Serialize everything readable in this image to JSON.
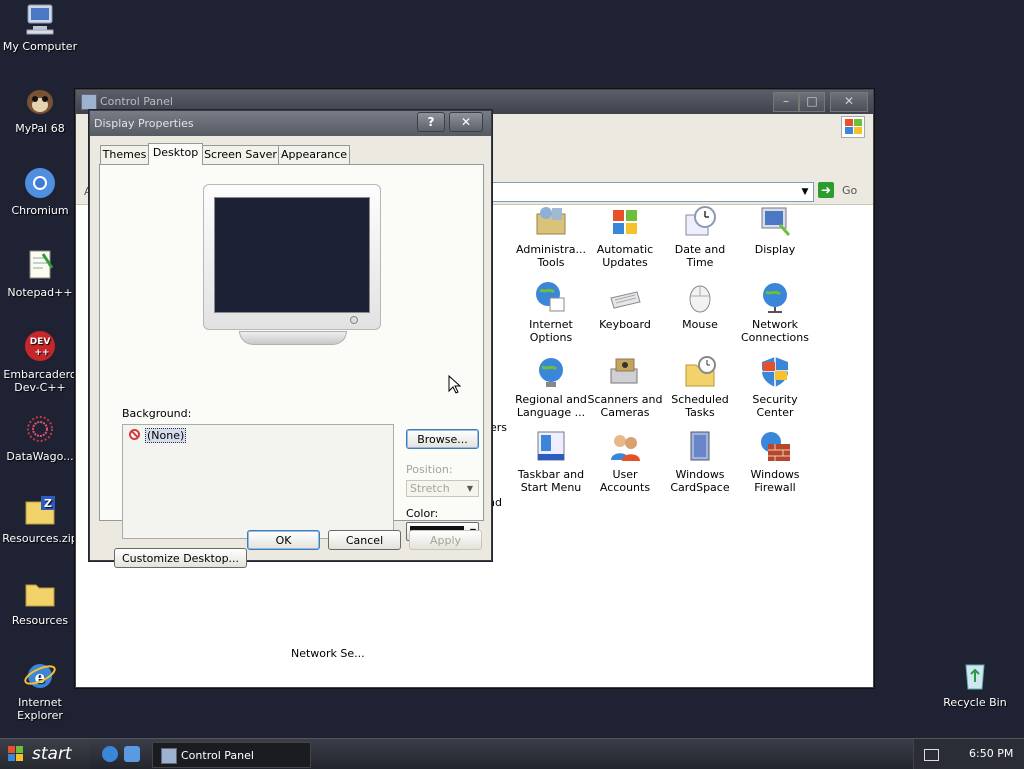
{
  "desktop": {
    "icons": [
      {
        "label": "My Computer",
        "icon": "computer-icon"
      },
      {
        "label": "MyPal 68",
        "icon": "mypal-icon"
      },
      {
        "label": "Chromium",
        "icon": "chromium-icon"
      },
      {
        "label": "Notepad++",
        "icon": "notepadpp-icon"
      },
      {
        "label": "Embarcadero Dev-C++",
        "icon": "devcpp-icon"
      },
      {
        "label": "DataWago...",
        "icon": "datawago-icon"
      },
      {
        "label": "Resources.zip",
        "icon": "zip-folder-icon"
      },
      {
        "label": "Resources",
        "icon": "folder-icon"
      },
      {
        "label": "Internet Explorer",
        "icon": "ie-icon"
      },
      {
        "label": "Recycle Bin",
        "icon": "recycle-bin-icon"
      }
    ]
  },
  "control_panel": {
    "title": "Control Panel",
    "address_go": "Go",
    "items": [
      {
        "label": "Administra... Tools"
      },
      {
        "label": "Automatic Updates"
      },
      {
        "label": "Date and Time"
      },
      {
        "label": "Display"
      },
      {
        "label": "Internet Options"
      },
      {
        "label": "Keyboard"
      },
      {
        "label": "Mouse"
      },
      {
        "label": "Network Connections"
      },
      {
        "label": "Regional and Language ..."
      },
      {
        "label": "Scanners and Cameras"
      },
      {
        "label": "Scheduled Tasks"
      },
      {
        "label": "Security Center"
      },
      {
        "label": "Taskbar and Start Menu"
      },
      {
        "label": "User Accounts"
      },
      {
        "label": "Windows CardSpace"
      },
      {
        "label": "Windows Firewall"
      }
    ],
    "partial_labels": {
      "a": "A",
      "dot": ".",
      "ers": "ers",
      "nd": "nd",
      "network_se": "Network Se..."
    }
  },
  "dialog": {
    "title": "Display Properties",
    "help_label": "?",
    "close_label": "✕",
    "tabs": [
      "Themes",
      "Desktop",
      "Screen Saver",
      "Appearance"
    ],
    "active_tab": "Desktop",
    "background_label": "Background:",
    "background_items": [
      "(None)"
    ],
    "browse_label": "Browse...",
    "position_label": "Position:",
    "position_value": "Stretch",
    "color_label": "Color:",
    "color_value": "#111111",
    "customize_label": "Customize Desktop...",
    "ok_label": "OK",
    "cancel_label": "Cancel",
    "apply_label": "Apply"
  },
  "taskbar": {
    "start_label": "start",
    "task_label": "Control Panel",
    "clock": "6:50 PM"
  }
}
